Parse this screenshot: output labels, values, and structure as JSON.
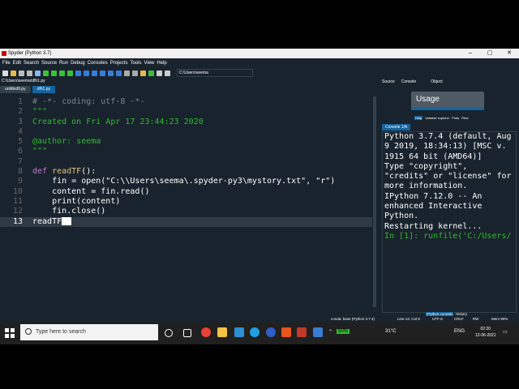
{
  "window": {
    "title": "Spyder (Python 3.7)",
    "controls": [
      "–",
      "▢",
      "✕"
    ]
  },
  "menu": [
    "File",
    "Edit",
    "Search",
    "Source",
    "Run",
    "Debug",
    "Consoles",
    "Projects",
    "Tools",
    "View",
    "Help"
  ],
  "toolbar": {
    "path": "C:\\Users\\seema"
  },
  "editor": {
    "file_path": "C:\\Users\\seema\\dfh1.py",
    "tabs": [
      "untitled0.py",
      "dfh1.py"
    ],
    "active_tab": 1,
    "lines": [
      {
        "num": "1",
        "text": "# -*- coding: utf-8 -*-"
      },
      {
        "num": "2",
        "text": "\"\"\""
      },
      {
        "num": "3",
        "text": "Created on Fri Apr 17 23:44:23 2020"
      },
      {
        "num": "4",
        "text": ""
      },
      {
        "num": "5",
        "text": "@author: seema"
      },
      {
        "num": "6",
        "text": "\"\"\""
      },
      {
        "num": "7",
        "text": ""
      },
      {
        "num": "8",
        "kw": "def",
        "fn": " readTF",
        "rest": "():"
      },
      {
        "num": "9",
        "text": "    fin = open(\"C:\\\\Users\\seema\\.spyder-py3\\mystory.txt\", \"r\")"
      },
      {
        "num": "10",
        "text": "    content = fin.read()"
      },
      {
        "num": "11",
        "text": "    print(content)"
      },
      {
        "num": "12",
        "text": "    fin.close()"
      },
      {
        "num": "13",
        "text": "readTF"
      }
    ]
  },
  "right_pane": {
    "top_tabs": [
      "Source",
      "Console",
      "Object"
    ],
    "help_title": "Usage",
    "help_tabs": [
      "Help",
      "Variable explorer",
      "Plots",
      "Files"
    ],
    "console_tab": "Console 1/A",
    "console_lines": [
      "Python 3.7.4 (default, Aug",
      "9 2019, 18:34:13) [MSC v.",
      "1915 64 bit (AMD64)]",
      "Type \"copyright\",",
      "\"credits\" or \"license\" for",
      "more information.",
      "",
      "IPython 7.12.0 -- An",
      "enhanced Interactive",
      "Python.",
      "",
      "Restarting kernel...",
      "",
      "",
      ""
    ],
    "console_prompt": "In [1]: runfile('C:/Users/",
    "bottom_tabs": [
      "IPython console",
      "History"
    ]
  },
  "statusbar": {
    "env": "conda: base (Python 3.7.4)",
    "position": "Line 13, Col 9",
    "encoding": "UTF-8",
    "eol": "CRLF",
    "rw": "RW",
    "mem": "Mem 90%"
  },
  "taskbar": {
    "search_placeholder": "Type here to search",
    "battery": "50%",
    "temp": "31°C",
    "lang": "ENG",
    "time": "02:20",
    "date": "12-06-2021"
  }
}
